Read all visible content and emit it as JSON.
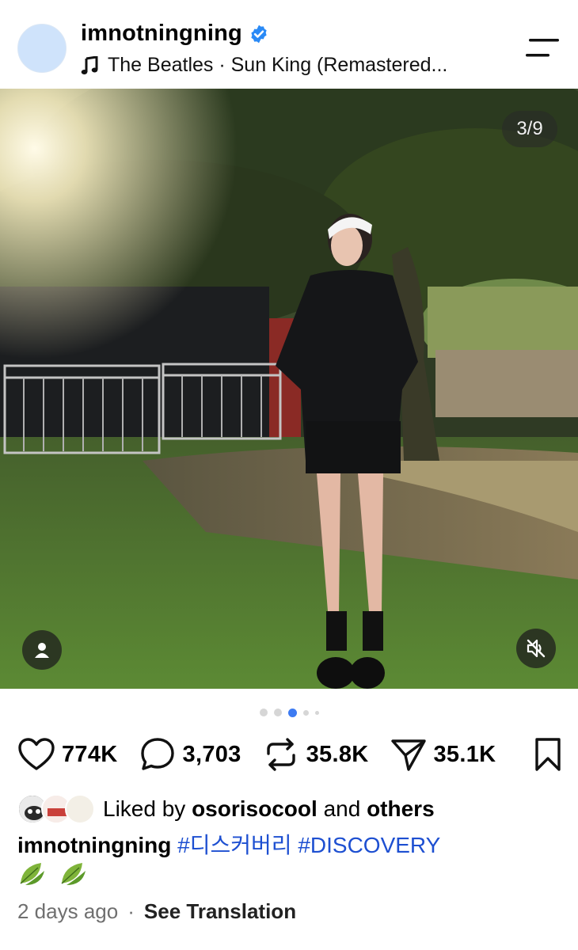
{
  "header": {
    "username": "imnotningning",
    "music_text": "The Beatles · Sun King (Remastered...",
    "verified_icon": "verified-badge-icon",
    "menu_icon": "hamburger-menu-icon"
  },
  "post": {
    "image_counter": "3/9",
    "carousel_dots": 5,
    "active_dot": 3
  },
  "actions": {
    "likes": "774K",
    "comments": "3,703",
    "reposts": "35.8K",
    "shares": "35.1K"
  },
  "liked_by": {
    "prefix": "Liked by",
    "user": "osorisocool",
    "and": "and",
    "others": "others"
  },
  "caption": {
    "user": "imnotningning",
    "tags": "#디스커버리 #DISCOVERY",
    "emoji": "🍃 🍃"
  },
  "meta": {
    "time": "2 days ago",
    "separator": "·",
    "translate": "See Translation"
  },
  "colors": {
    "accent": "#3d7bf2",
    "hashtag": "#1d4fd1",
    "verified": "#2a8af6"
  }
}
